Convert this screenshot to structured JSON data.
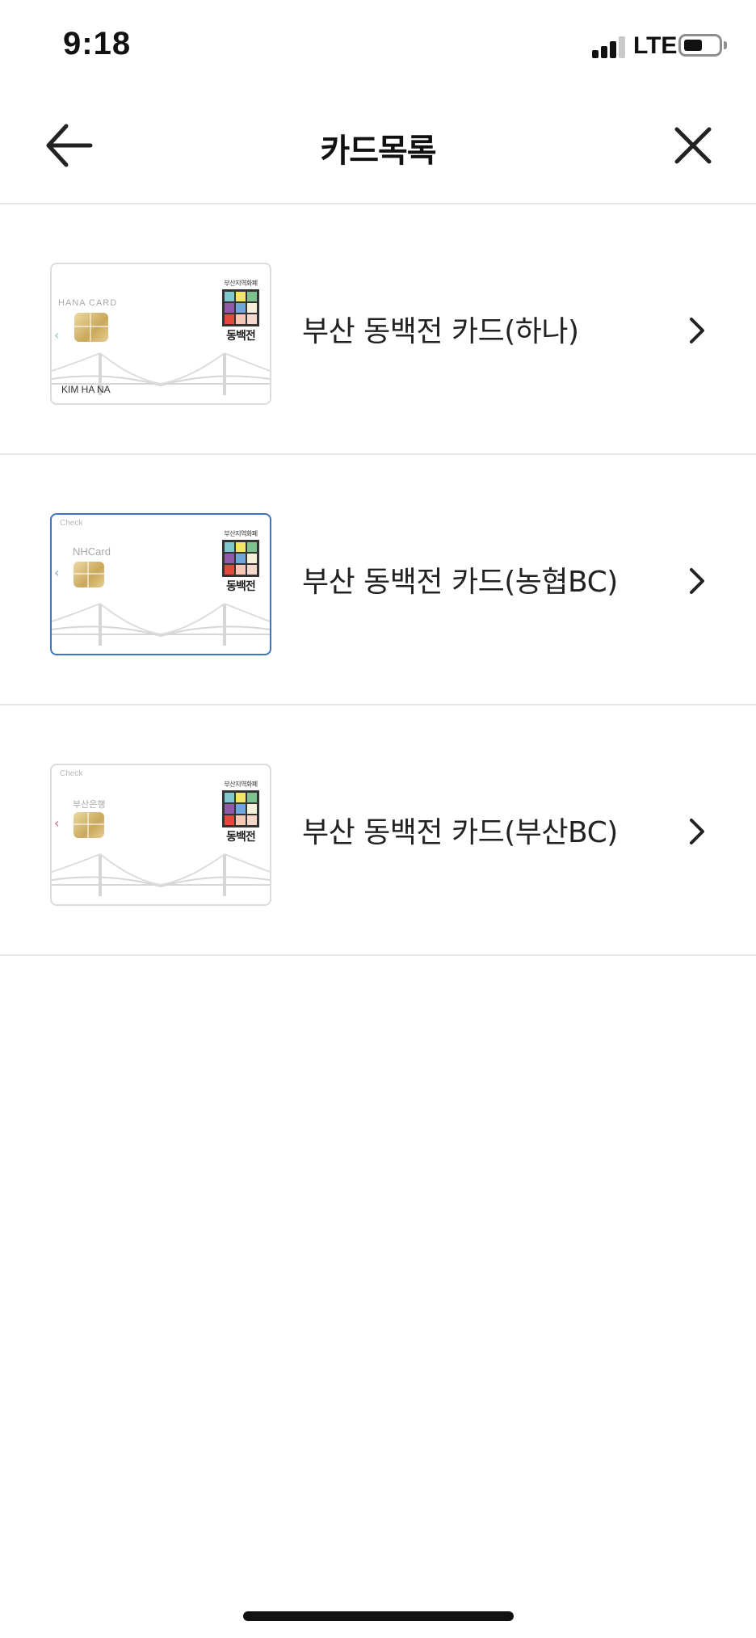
{
  "status_bar": {
    "time": "9:18",
    "network": "LTE"
  },
  "header": {
    "title": "카드목록",
    "back_icon": "arrow-left-icon",
    "close_icon": "close-icon"
  },
  "cards": [
    {
      "label": "부산 동백전 카드(하나)",
      "card_brand": "HANA CARD",
      "holder": "KIM HA NA",
      "check": "",
      "logo_top": "부산지역화폐",
      "logo_bottom": "동백전",
      "selected": false
    },
    {
      "label": "부산 동백전 카드(농협BC)",
      "card_brand": "NHCard",
      "holder": "",
      "check": "Check",
      "logo_top": "부산지역화폐",
      "logo_bottom": "동백전",
      "selected": true
    },
    {
      "label": "부산 동백전 카드(부산BC)",
      "card_brand": "부산은행",
      "holder": "",
      "check": "Check",
      "logo_top": "부산지역화폐",
      "logo_bottom": "동백전",
      "selected": false
    }
  ],
  "colors": {
    "selected_border": "#3d73c4",
    "divider": "#e6e6e6",
    "text": "#222222"
  }
}
